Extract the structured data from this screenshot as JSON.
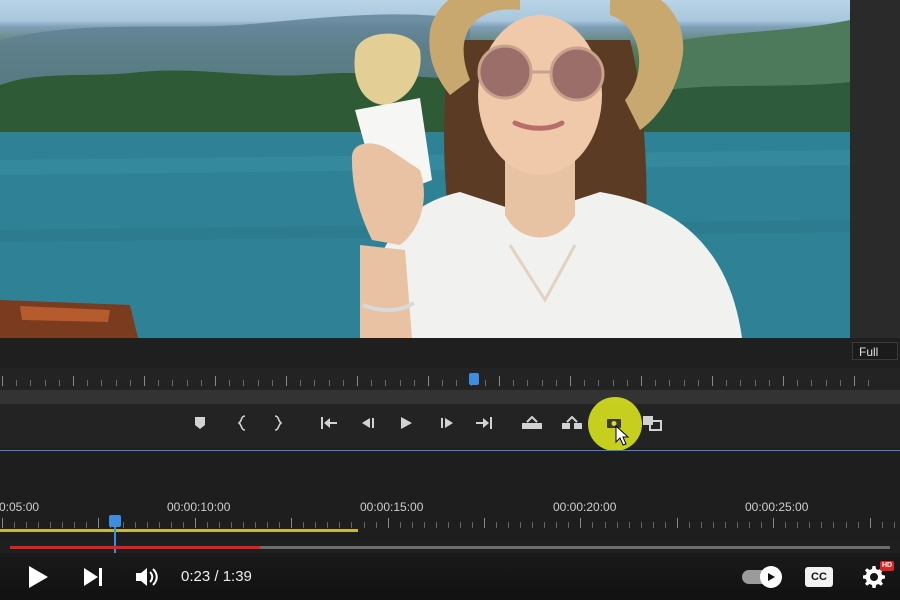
{
  "monitor": {
    "zoom_level": "Full"
  },
  "sequence_timeline": {
    "timecodes": [
      "0:05:00",
      "00:00:10:00",
      "00:00:15:00",
      "00:00:20:00",
      "00:00:25:00"
    ]
  },
  "transport": {
    "icons": [
      "marker-icon",
      "mark-in-icon",
      "mark-out-icon",
      "go-to-in-icon",
      "step-back-icon",
      "play-icon",
      "step-forward-icon",
      "go-to-out-icon",
      "lift-icon",
      "extract-icon",
      "export-frame-icon",
      "comparison-view-icon"
    ]
  },
  "player": {
    "current_time": "0:23",
    "duration": "1:39",
    "time_display": "0:23 / 1:39",
    "progress": 0.284,
    "cc_label": "CC",
    "hd_badge": "HD",
    "accent_color": "#e32020",
    "highlight_color": "#d6de1e",
    "playhead_color": "#3d8de0"
  }
}
